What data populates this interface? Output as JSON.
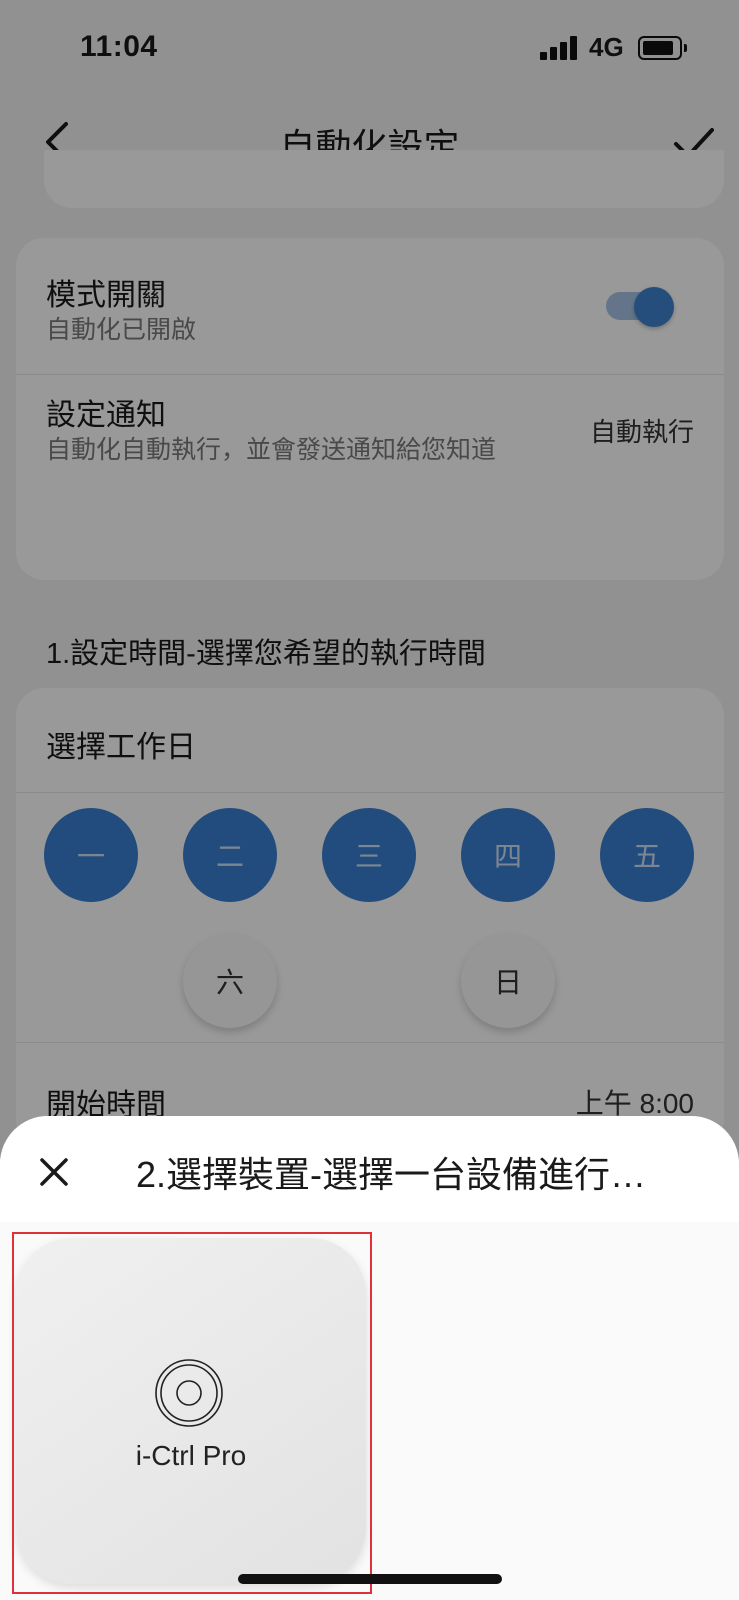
{
  "status_bar": {
    "time": "11:04",
    "network": "4G",
    "battery_level": 0.85
  },
  "nav": {
    "title": "自動化設定",
    "back_icon": "chevron-left-icon",
    "confirm_icon": "check-icon"
  },
  "mode_card": {
    "mode_switch": {
      "label": "模式開關",
      "sublabel": "自動化已開啟",
      "enabled": true
    },
    "notification": {
      "label": "設定通知",
      "sublabel": "自動化自動執行，並會發送通知給您知道",
      "value": "自動執行"
    }
  },
  "section1": {
    "heading": "1.設定時間-選擇您希望的執行時間"
  },
  "schedule_card": {
    "weekday_label": "選擇工作日",
    "days": [
      {
        "label": "一",
        "selected": true
      },
      {
        "label": "二",
        "selected": true
      },
      {
        "label": "三",
        "selected": true
      },
      {
        "label": "四",
        "selected": true
      },
      {
        "label": "五",
        "selected": true
      },
      {
        "label": "六",
        "selected": false
      },
      {
        "label": "日",
        "selected": false
      }
    ],
    "start_time": {
      "label": "開始時間",
      "value": "上午 8:00"
    }
  },
  "sheet": {
    "title": "2.選擇裝置-選擇一台設備進行…",
    "close_icon": "close-icon",
    "devices": [
      {
        "name": "i-Ctrl Pro",
        "icon": "device-ring-icon"
      }
    ]
  },
  "colors": {
    "accent": "#3a7fd0",
    "highlight_border": "#e0303a"
  }
}
